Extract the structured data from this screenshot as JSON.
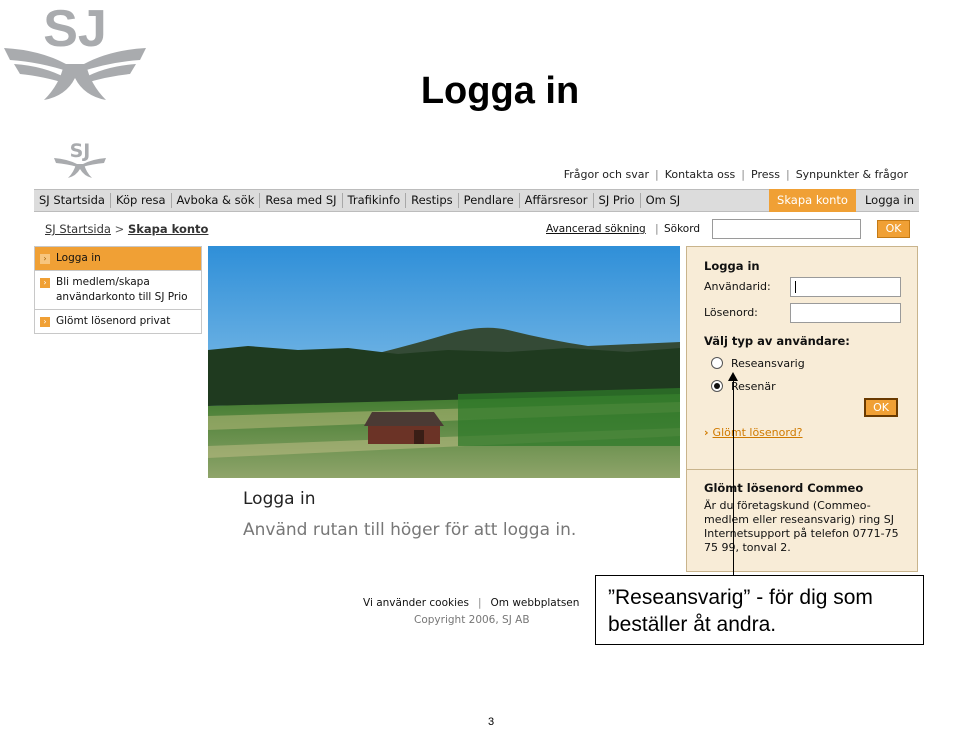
{
  "slide": {
    "title": "Logga in",
    "page_number": "3",
    "logo_icon": "sj-logo-icon"
  },
  "site": {
    "logo_icon": "sj-logo-icon",
    "top_links": [
      "Frågor och svar",
      "Kontakta oss",
      "Press",
      "Synpunkter & frågor"
    ],
    "nav": [
      "SJ Startsida",
      "Köp resa",
      "Avboka & sök",
      "Resa med SJ",
      "Trafikinfo",
      "Restips",
      "Pendlare",
      "Affärsresor",
      "SJ Prio",
      "Om SJ"
    ],
    "nav_right": {
      "create_account": "Skapa konto",
      "login": "Logga in"
    },
    "breadcrumb": {
      "home": "SJ Startsida",
      "separator": ">",
      "current": "Skapa konto"
    },
    "search": {
      "advanced": "Avancerad sökning",
      "label": "Sökord",
      "value": "",
      "button": "OK"
    },
    "left_menu": [
      "Logga in",
      "Bli medlem/skapa användarkonto till SJ Prio",
      "Glömt lösenord privat"
    ],
    "hero": {
      "title": "Logga in",
      "text": "Använd rutan till höger för att logga in."
    },
    "login": {
      "title": "Logga in",
      "username_label": "Användarid:",
      "password_label": "Lösenord:",
      "username_value": "",
      "password_value": "",
      "user_type_title": "Välj typ av användare:",
      "options": [
        {
          "label": "Reseansvarig",
          "selected": false
        },
        {
          "label": "Resenär",
          "selected": true
        }
      ],
      "ok": "OK",
      "forgot": "Glömt lösenord?"
    },
    "commeo": {
      "title": "Glömt lösenord Commeo",
      "text": "Är du företagskund (Commeo-medlem eller reseansvarig) ring SJ Internetsupport på telefon 0771-75 75 99, tonval 2."
    },
    "footer": {
      "cookies": "Vi använder cookies",
      "about": "Om webbplatsen",
      "copyright": "Copyright 2006, SJ AB"
    }
  },
  "callout": {
    "line1": "”Reseansvarig” - för dig som",
    "line2": "beställer åt andra."
  },
  "colors": {
    "accent": "#f0a035",
    "login_bg": "#f8ecd7",
    "logo_gray": "#a9abae"
  }
}
